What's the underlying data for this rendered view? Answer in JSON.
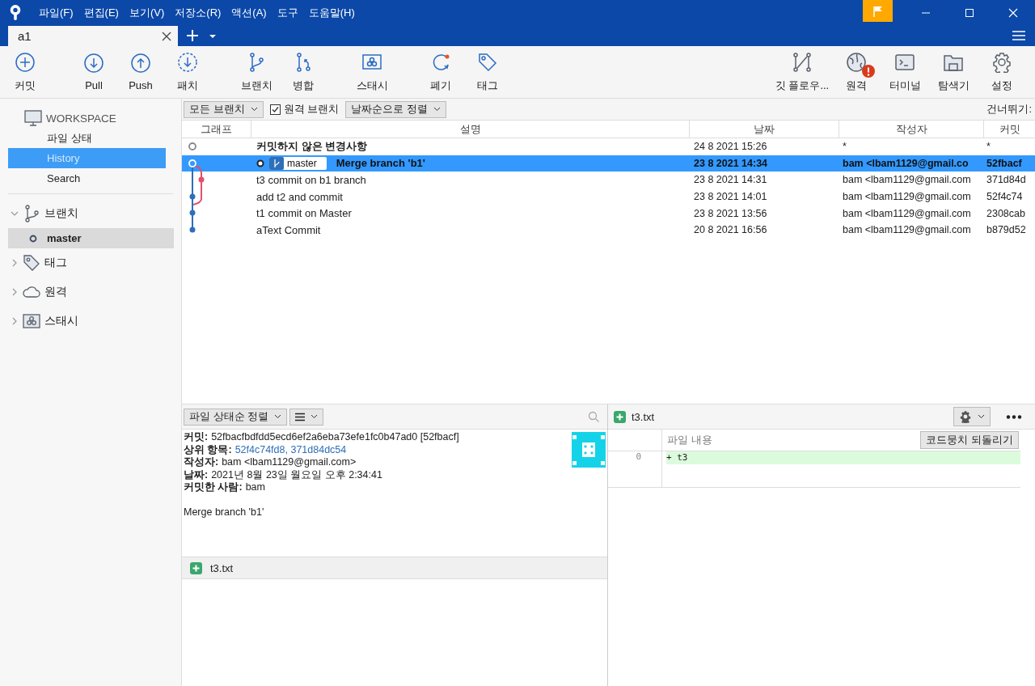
{
  "menu": [
    "파일(F)",
    "편집(E)",
    "보기(V)",
    "저장소(R)",
    "액션(A)",
    "도구",
    "도움말(H)"
  ],
  "tabs": [
    {
      "label": "a1",
      "selected": true
    }
  ],
  "toolbar_left": [
    "커밋",
    "Pull",
    "Push",
    "패치",
    "브랜치",
    "병합",
    "스태시",
    "폐기",
    "태그"
  ],
  "toolbar_right": [
    {
      "label": "깃 플로우...",
      "alert": false
    },
    {
      "label": "원격",
      "alert": true
    },
    {
      "label": "터미널",
      "alert": false
    },
    {
      "label": "탐색기",
      "alert": false
    },
    {
      "label": "설정",
      "alert": false
    }
  ],
  "sidebar": {
    "workspace": {
      "title": "WORKSPACE",
      "items": [
        {
          "label": "파일 상태",
          "selected": false
        },
        {
          "label": "History",
          "selected": true
        },
        {
          "label": "Search",
          "selected": false
        }
      ]
    },
    "sections": [
      {
        "label": "브랜치",
        "expanded": true,
        "children": [
          {
            "label": "master",
            "current": true
          }
        ]
      },
      {
        "label": "태그",
        "expanded": false
      },
      {
        "label": "원격",
        "expanded": false
      },
      {
        "label": "스태시",
        "expanded": false
      }
    ]
  },
  "filter_bar": {
    "branches": "모든 브랜치",
    "remote": {
      "label": "원격 브랜치",
      "checked": true
    },
    "sort": "날짜순으로 정렬",
    "skip": "건너뛰기:"
  },
  "table": {
    "columns": [
      "그래프",
      "설명",
      "날짜",
      "작성자",
      "커밋"
    ],
    "rows": [
      {
        "kind": "uncommitted",
        "selected": false,
        "description": "커밋하지 않은 변경사항",
        "date": "24 8 2021 15:26",
        "author": "*",
        "commit": "*"
      },
      {
        "kind": "commit",
        "selected": true,
        "branch_tag": "master",
        "description": "Merge branch 'b1'",
        "date": "23 8 2021 14:34",
        "author": "bam <lbam1129@gmail.co",
        "commit": "52fbacf"
      },
      {
        "kind": "commit",
        "selected": false,
        "description": "t3 commit on b1 branch",
        "date": "23 8 2021 14:31",
        "author": "bam <lbam1129@gmail.com",
        "commit": "371d84d"
      },
      {
        "kind": "commit",
        "selected": false,
        "description": "add t2 and commit",
        "date": "23 8 2021 14:01",
        "author": "bam <lbam1129@gmail.com",
        "commit": "52f4c74"
      },
      {
        "kind": "commit",
        "selected": false,
        "description": "t1 commit on Master",
        "date": "23 8 2021 13:56",
        "author": "bam <lbam1129@gmail.com",
        "commit": "2308cab"
      },
      {
        "kind": "commit",
        "selected": false,
        "description": "aText Commit",
        "date": "20 8 2021 16:56",
        "author": "bam <lbam1129@gmail.com",
        "commit": "b879d52"
      }
    ]
  },
  "details": {
    "sort": "파일 상태순 정렬",
    "fields": [
      {
        "label": "커밋:",
        "value": "52fbacfbdfdd5ecd6ef2a6eba73efe1fc0b47ad0 [52fbacf]"
      },
      {
        "label": "상위 항목:",
        "links": "52f4c74fd8, 371d84dc54"
      },
      {
        "label": "작성자:",
        "value": "bam <lbam1129@gmail.com>"
      },
      {
        "label": "날짜:",
        "value": "2021년 8월 23일 월요일 오후 2:34:41"
      },
      {
        "label": "커밋한 사람:",
        "value": "bam"
      }
    ],
    "message": "Merge branch 'b1'",
    "files": [
      {
        "name": "t3.txt",
        "kind": "added"
      }
    ]
  },
  "diff": {
    "file": "t3.txt",
    "kind": "added",
    "header": "파일 내용",
    "revert_button": "코드뭉치 되돌리기",
    "lines": [
      {
        "number": "0",
        "text": "+ t3",
        "kind": "added"
      }
    ]
  }
}
